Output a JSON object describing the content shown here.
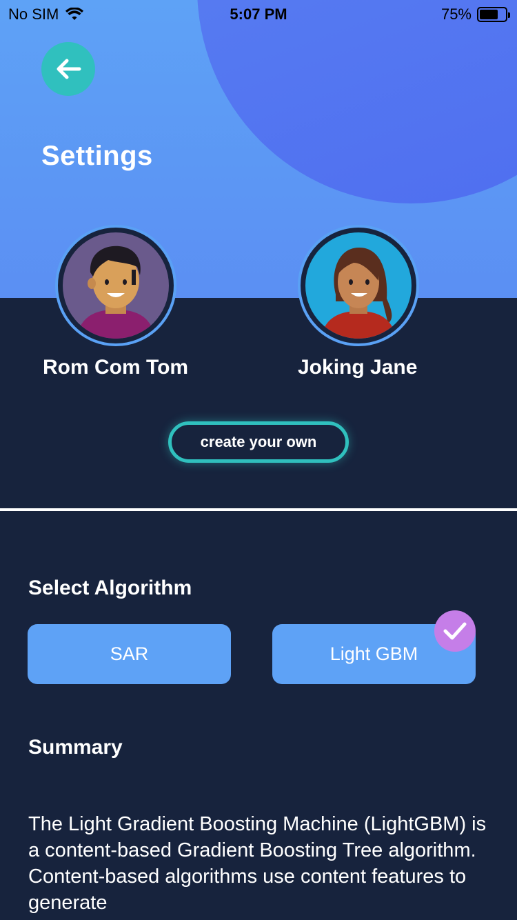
{
  "status_bar": {
    "carrier": "No SIM",
    "time": "5:07 PM",
    "battery_pct": "75%",
    "battery_level": 0.75
  },
  "header": {
    "title": "Settings",
    "back_icon": "arrow-left-icon"
  },
  "personas": [
    {
      "name": "Rom Com Tom",
      "avatar_bg": "#6a5a8c"
    },
    {
      "name": "Joking Jane",
      "avatar_bg": "#22a8dc"
    }
  ],
  "create_button": {
    "label": "create your own"
  },
  "algorithm": {
    "section_title": "Select Algorithm",
    "options": [
      {
        "label": "SAR",
        "selected": false
      },
      {
        "label": "Light GBM",
        "selected": true
      }
    ]
  },
  "summary": {
    "section_title": "Summary",
    "text": "The Light Gradient Boosting Machine (LightGBM) is a content-based Gradient Boosting Tree algorithm. Content-based algorithms use content features to generate"
  },
  "colors": {
    "background": "#17233d",
    "header_gradient": "#5ea2f6",
    "accent_teal": "#30c0be",
    "button_blue": "#5ea2f6",
    "check_purple": "#c57ee8"
  }
}
